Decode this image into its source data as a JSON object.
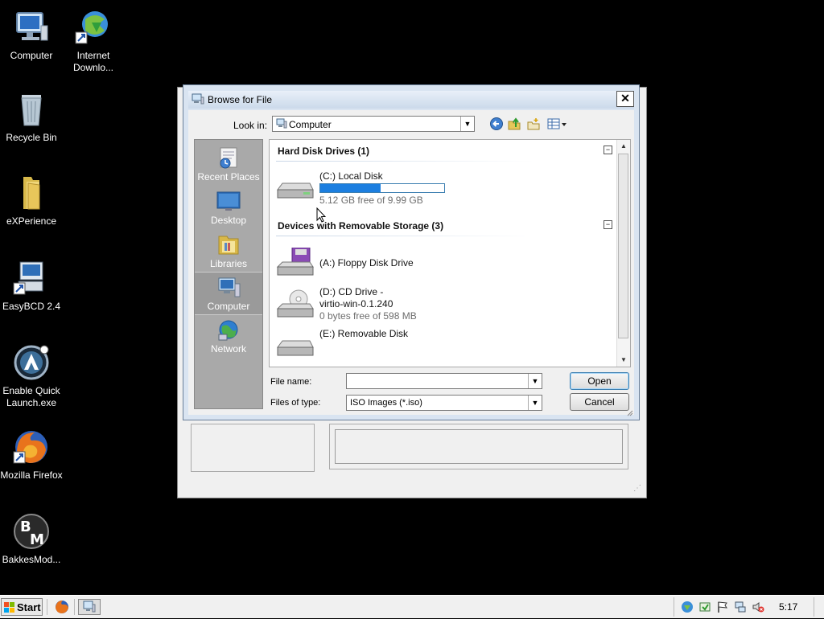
{
  "desktop": {
    "icons": [
      {
        "label": "Computer",
        "icon": "computer-icon"
      },
      {
        "label": "Internet Downlo...",
        "icon": "internet-download-manager-icon"
      },
      {
        "label": "Recycle Bin",
        "icon": "recycle-bin-icon"
      },
      {
        "label": "eXPerience",
        "icon": "folder-icon"
      },
      {
        "label": "EasyBCD 2.4",
        "icon": "easybcd-icon"
      },
      {
        "label": "Enable Quick Launch.exe",
        "icon": "quick-launch-icon"
      },
      {
        "label": "Mozilla Firefox",
        "icon": "firefox-icon"
      },
      {
        "label": "BakkesMod...",
        "icon": "bakkesmod-icon"
      }
    ]
  },
  "dialog": {
    "title": "Browse for File",
    "close_glyph": "✕",
    "lookin_label": "Look in:",
    "lookin_value": "Computer",
    "places": [
      {
        "label": "Recent Places",
        "icon": "recent-places-icon"
      },
      {
        "label": "Desktop",
        "icon": "desktop-icon"
      },
      {
        "label": "Libraries",
        "icon": "libraries-icon"
      },
      {
        "label": "Computer",
        "icon": "computer-icon",
        "selected": true
      },
      {
        "label": "Network",
        "icon": "network-icon"
      }
    ],
    "groups": [
      {
        "header": "Hard Disk Drives (1)",
        "collapse_glyph": "−",
        "items": [
          {
            "name": "(C:) Local Disk",
            "sub": "5.12 GB free of 9.99 GB",
            "used_fraction": 0.49
          }
        ]
      },
      {
        "header": "Devices with Removable Storage (3)",
        "collapse_glyph": "−",
        "items": [
          {
            "name": "(A:) Floppy Disk Drive"
          },
          {
            "name": "(D:) CD Drive -",
            "name2": "virtio-win-0.1.240",
            "sub": "0 bytes free of 598 MB"
          },
          {
            "name": "(E:) Removable Disk"
          }
        ]
      }
    ],
    "file_name_label": "File name:",
    "file_name_value": "",
    "files_of_type_label": "Files of type:",
    "files_of_type_value": "ISO Images (*.iso)",
    "open_label": "Open",
    "cancel_label": "Cancel"
  },
  "taskbar": {
    "start_label": "Start",
    "clock": "5:17"
  }
}
